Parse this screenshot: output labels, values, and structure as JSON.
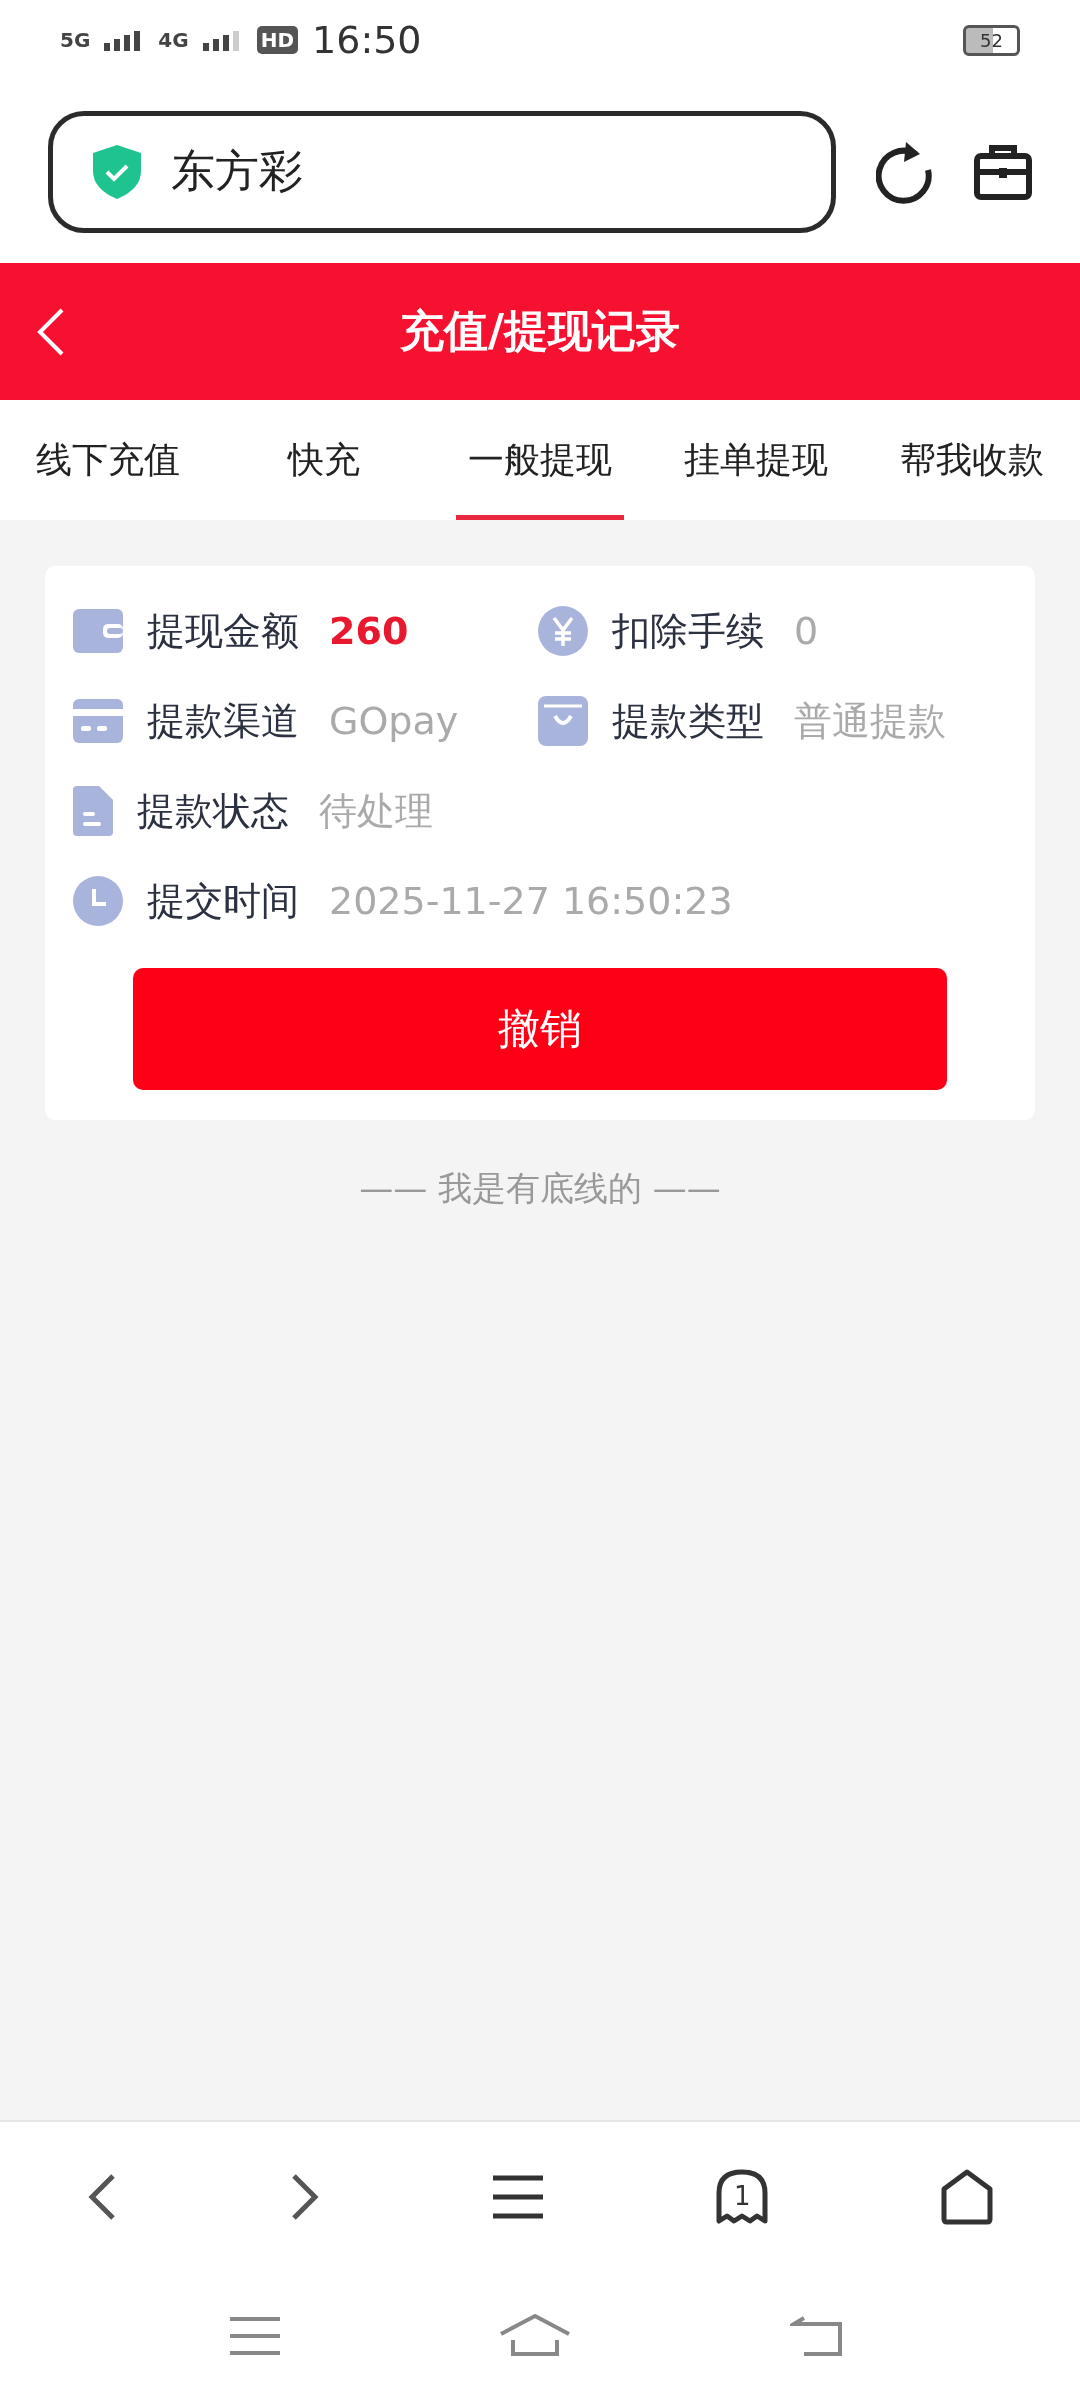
{
  "status_bar": {
    "network_1": "5G",
    "network_2": "4G",
    "hd": "HD",
    "time": "16:50",
    "battery": "52"
  },
  "address_bar": {
    "value": "东方彩"
  },
  "header": {
    "title": "充值/提现记录"
  },
  "tabs": [
    {
      "label": "线下充值",
      "selected": false
    },
    {
      "label": "快充",
      "selected": false
    },
    {
      "label": "一般提现",
      "selected": true
    },
    {
      "label": "挂单提现",
      "selected": false
    },
    {
      "label": "帮我收款",
      "selected": false
    }
  ],
  "record": {
    "rows": [
      [
        {
          "label": "提现金额",
          "value": "260",
          "kind": "amount"
        },
        {
          "label": "扣除手续",
          "value": "0",
          "kind": "plain"
        }
      ],
      [
        {
          "label": "提款渠道",
          "value": "GOpay",
          "kind": "plain"
        },
        {
          "label": "提款类型",
          "value": "普通提款",
          "kind": "plain"
        }
      ],
      [
        {
          "label": "提款状态",
          "value": "待处理",
          "kind": "plain"
        }
      ],
      [
        {
          "label": "提交时间",
          "value": "2025-11-27 16:50:23",
          "kind": "plain"
        }
      ]
    ],
    "button": "撤销"
  },
  "end_note": "—— 我是有底线的 ——",
  "browser_bar": {
    "tab_count": "1"
  }
}
